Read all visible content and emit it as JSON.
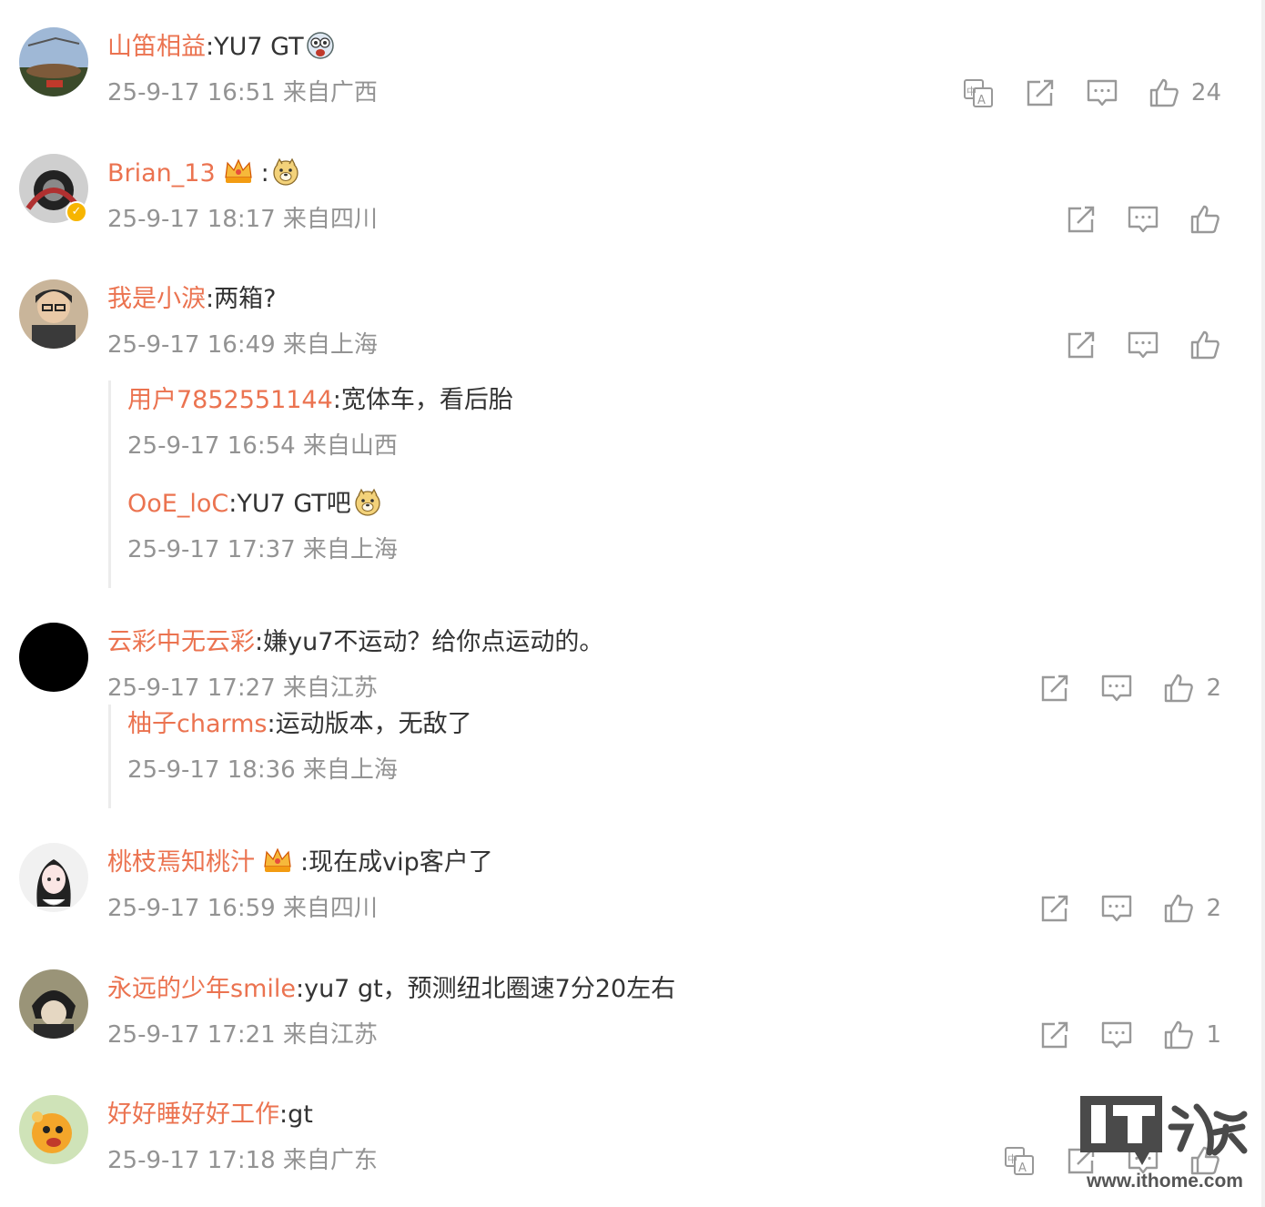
{
  "comments": [
    {
      "user": "山笛相益",
      "text": "YU7 GT",
      "emoji": "shocked-emoji",
      "meta": "25-9-17 16:51 来自广西",
      "translate": true,
      "likes": "24"
    },
    {
      "user": "Brian_13",
      "text": "",
      "emoji": "doge-emoji",
      "crown": true,
      "verified": true,
      "meta": "25-9-17 18:17 来自四川",
      "translate": false,
      "likes": ""
    },
    {
      "user": "我是小淚",
      "text": "两箱?",
      "meta": "25-9-17 16:49 来自上海",
      "translate": false,
      "likes": "",
      "replies": [
        {
          "user": "用户7852551144",
          "text": "宽体车，看后胎",
          "meta": "25-9-17 16:54 来自山西"
        },
        {
          "user": "OoE_loC",
          "text": "YU7 GT吧",
          "emoji": "doge-emoji",
          "meta": "25-9-17 17:37 来自上海"
        }
      ]
    },
    {
      "user": "云彩中无云彩",
      "text": "嫌yu7不运动？给你点运动的。",
      "meta": "25-9-17 17:27 来自江苏",
      "translate": false,
      "likes": "2",
      "replies": [
        {
          "user": "柚子charms",
          "text": "运动版本，无敌了",
          "meta": "25-9-17 18:36 来自上海"
        }
      ]
    },
    {
      "user": "桃枝焉知桃汁",
      "text": "现在成vip客户了",
      "crown": true,
      "meta": "25-9-17 16:59 来自四川",
      "translate": false,
      "likes": "2"
    },
    {
      "user": "永远的少年smile",
      "text": "yu7 gt，预测纽北圈速7分20左右",
      "meta": "25-9-17 17:21 来自江苏",
      "translate": false,
      "likes": "1"
    },
    {
      "user": "好好睡好好工作",
      "text": "gt",
      "meta": "25-9-17 17:18 来自广东",
      "translate": true,
      "likes": ""
    }
  ],
  "watermark": {
    "logo": "IT之家",
    "url": "www.ithome.com"
  },
  "colors": {
    "username": "#eb7350",
    "meta": "#939393",
    "text": "#333333"
  }
}
